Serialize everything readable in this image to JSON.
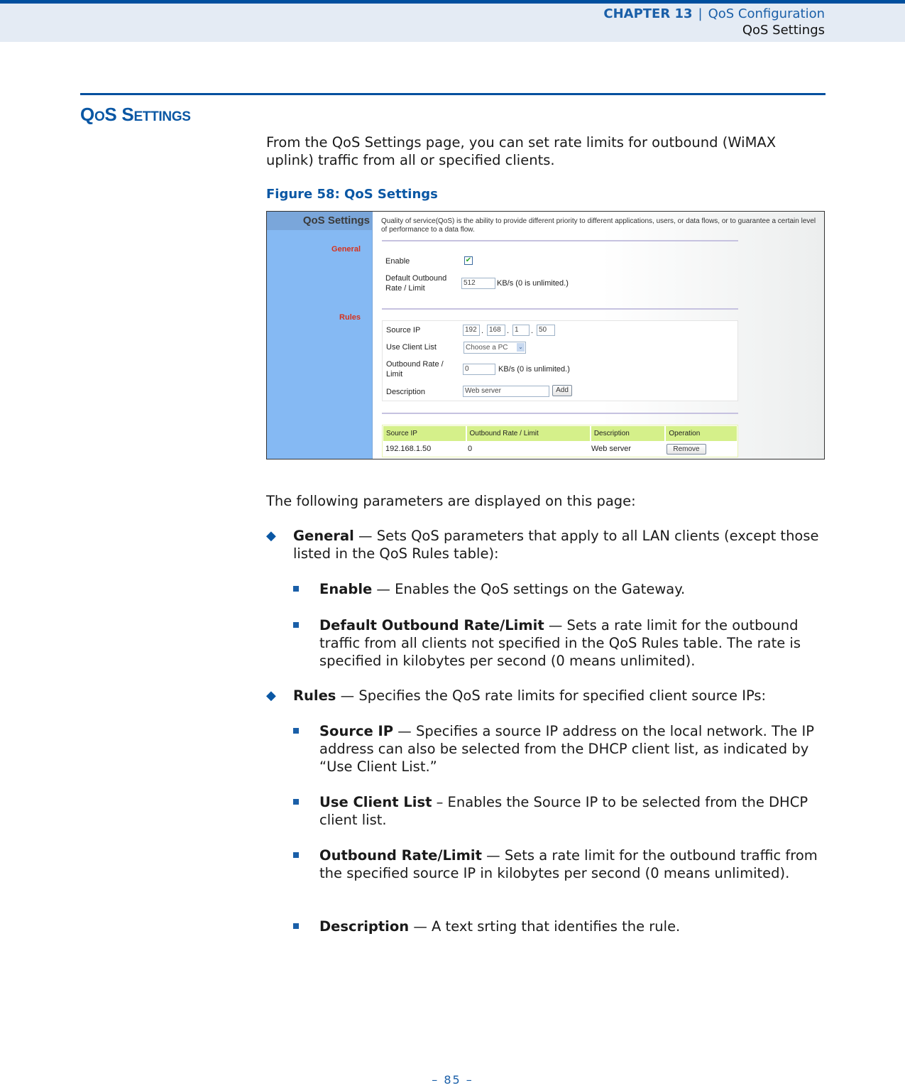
{
  "header": {
    "chapter_label": "CHAPTER 13",
    "separator": "|",
    "chapter_title": "QoS Configuration",
    "section": "QoS Settings"
  },
  "section": {
    "title_big1": "Q",
    "title_small1": "O",
    "title_big2": "S S",
    "title_small2": "ETTINGS",
    "intro": "From the QoS Settings page, you can set rate limits for outbound (WiMAX uplink) traffic from all or specified clients."
  },
  "figure": {
    "caption": "Figure 58:  QoS Settings",
    "sidebar_title": "QoS Settings",
    "sidebar_general": "General",
    "sidebar_rules": "Rules",
    "description": "Quality of service(QoS) is the ability to provide different priority to different applications, users, or data flows, or to guarantee a certain level of performance to a data flow.",
    "general": {
      "enable_label": "Enable",
      "enable_checked": true,
      "enable_check_glyph": "✔",
      "default_rate_label_1": "Default Outbound",
      "default_rate_label_2": "Rate / Limit",
      "default_rate_value": "512",
      "unit_label": "KB/s (0 is unlimited.)"
    },
    "rules": {
      "source_ip_label": "Source IP",
      "ip_octets": [
        "192",
        "168",
        "1",
        "50"
      ],
      "ip_dot": ".",
      "client_list_label": "Use Client List",
      "client_list_selected": "Choose a PC",
      "client_list_arrow": "⌄",
      "rate_label_1": "Outbound Rate /",
      "rate_label_2": "Limit",
      "rate_value": "0",
      "unit_label": "KB/s (0 is unlimited.)",
      "description_label": "Description",
      "description_value": "Web server",
      "add_button": "Add"
    },
    "table": {
      "headers": [
        "Source IP",
        "Outbound Rate / Limit",
        "Description",
        "Operation"
      ],
      "rows": [
        {
          "source_ip": "192.168.1.50",
          "rate": "0",
          "description": "Web server",
          "operation": "Remove"
        }
      ]
    }
  },
  "params": {
    "intro": "The following parameters are displayed on this page:",
    "diamond_glyph": "◆",
    "general": {
      "term": "General",
      "text": " — Sets QoS parameters that apply to all LAN clients (except those listed in the QoS Rules table):",
      "items": [
        {
          "term": "Enable",
          "text": " — Enables the QoS settings on the Gateway."
        },
        {
          "term": "Default Outbound Rate/Limit",
          "text": " — Sets a rate limit for the outbound traffic from all clients not specified in the QoS Rules table. The rate is specified in kilobytes per second (0 means unlimited)."
        }
      ]
    },
    "rules": {
      "term": "Rules",
      "text": " — Specifies the QoS rate limits for specified client source IPs:",
      "items": [
        {
          "term": "Source IP",
          "text": " — Specifies a source IP address on the local network. The IP address can also be selected from the DHCP client list, as indicated by “Use Client List.”"
        },
        {
          "term": "Use Client List",
          "text": " – Enables the Source IP to be selected from the DHCP client list."
        },
        {
          "term": "Outbound Rate/Limit",
          "text": " — Sets a rate limit for the outbound traffic from the specified source IP in kilobytes per second (0 means unlimited)."
        },
        {
          "term": "Description",
          "text": " — A text srting that identifies the rule."
        }
      ]
    }
  },
  "footer": {
    "page": "–  85  –"
  }
}
